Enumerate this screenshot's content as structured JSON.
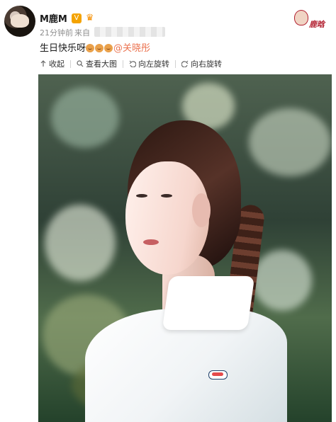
{
  "post": {
    "username": "M鹿M",
    "time": "21分钟前",
    "source_prefix": "来自",
    "text": "生日快乐呀",
    "mention": "@关晓彤"
  },
  "toolbar": {
    "collapse": "收起",
    "view_large": "查看大图",
    "rotate_left": "向左旋转",
    "rotate_right": "向右旋转"
  },
  "icons": {
    "verified": "verified-badge-icon",
    "vip": "vip-icon",
    "cake_emoji": "cake-emoji-icon",
    "collapse": "arrow-up-icon",
    "zoom": "magnifier-icon",
    "rotate_left": "rotate-left-icon",
    "rotate_right": "rotate-right-icon"
  },
  "colors": {
    "mention": "#eb7350",
    "verified": "#f4a300",
    "vip": "#f68f00"
  },
  "brand": {
    "text": "鹿晗"
  }
}
